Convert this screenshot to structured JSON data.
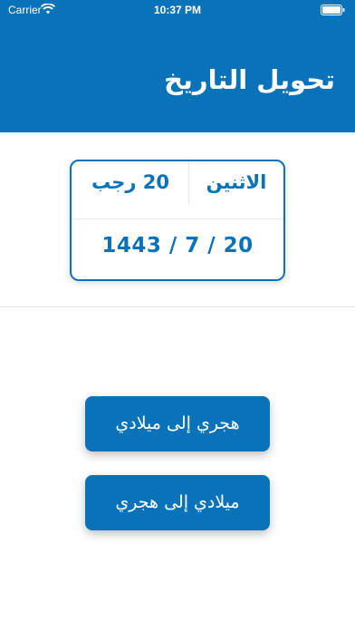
{
  "status_bar": {
    "carrier": "Carrier",
    "time": "10:37 PM"
  },
  "header": {
    "title": "تحويل التاريخ",
    "background_color": "#0a72b8"
  },
  "date_card": {
    "day_name": "الاثنين",
    "day_month": "20 رجب",
    "numeric_date": "1443 / 7 / 20",
    "accent_color": "#0a72b8"
  },
  "actions": {
    "hijri_to_gregorian_label": "هجري إلى ميلادي",
    "gregorian_to_hijri_label": "ميلادي إلى هجري"
  },
  "icons": {
    "wifi": "wifi-icon",
    "battery": "battery-icon"
  }
}
